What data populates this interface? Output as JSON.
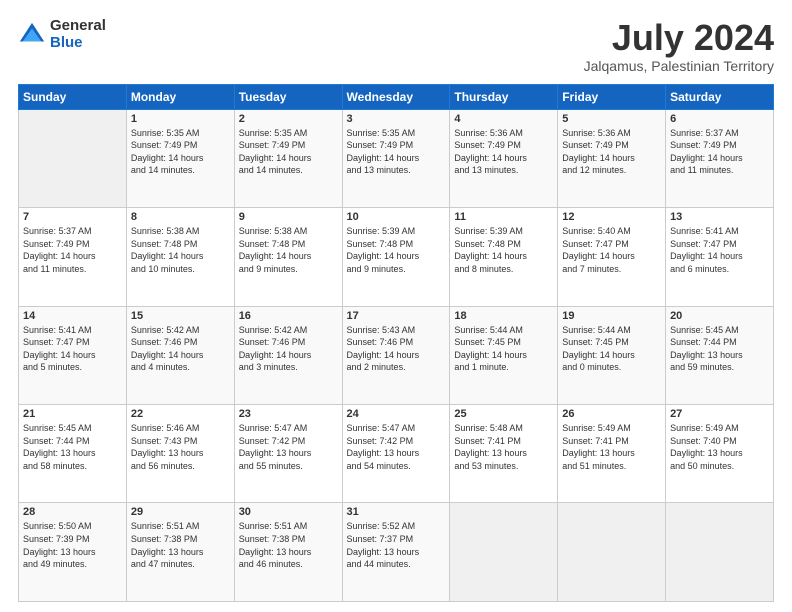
{
  "logo": {
    "general": "General",
    "blue": "Blue"
  },
  "header": {
    "month": "July 2024",
    "location": "Jalqamus, Palestinian Territory"
  },
  "days_of_week": [
    "Sunday",
    "Monday",
    "Tuesday",
    "Wednesday",
    "Thursday",
    "Friday",
    "Saturday"
  ],
  "weeks": [
    [
      {
        "day": "",
        "info": ""
      },
      {
        "day": "1",
        "info": "Sunrise: 5:35 AM\nSunset: 7:49 PM\nDaylight: 14 hours\nand 14 minutes."
      },
      {
        "day": "2",
        "info": "Sunrise: 5:35 AM\nSunset: 7:49 PM\nDaylight: 14 hours\nand 14 minutes."
      },
      {
        "day": "3",
        "info": "Sunrise: 5:35 AM\nSunset: 7:49 PM\nDaylight: 14 hours\nand 13 minutes."
      },
      {
        "day": "4",
        "info": "Sunrise: 5:36 AM\nSunset: 7:49 PM\nDaylight: 14 hours\nand 13 minutes."
      },
      {
        "day": "5",
        "info": "Sunrise: 5:36 AM\nSunset: 7:49 PM\nDaylight: 14 hours\nand 12 minutes."
      },
      {
        "day": "6",
        "info": "Sunrise: 5:37 AM\nSunset: 7:49 PM\nDaylight: 14 hours\nand 11 minutes."
      }
    ],
    [
      {
        "day": "7",
        "info": "Sunrise: 5:37 AM\nSunset: 7:49 PM\nDaylight: 14 hours\nand 11 minutes."
      },
      {
        "day": "8",
        "info": "Sunrise: 5:38 AM\nSunset: 7:48 PM\nDaylight: 14 hours\nand 10 minutes."
      },
      {
        "day": "9",
        "info": "Sunrise: 5:38 AM\nSunset: 7:48 PM\nDaylight: 14 hours\nand 9 minutes."
      },
      {
        "day": "10",
        "info": "Sunrise: 5:39 AM\nSunset: 7:48 PM\nDaylight: 14 hours\nand 9 minutes."
      },
      {
        "day": "11",
        "info": "Sunrise: 5:39 AM\nSunset: 7:48 PM\nDaylight: 14 hours\nand 8 minutes."
      },
      {
        "day": "12",
        "info": "Sunrise: 5:40 AM\nSunset: 7:47 PM\nDaylight: 14 hours\nand 7 minutes."
      },
      {
        "day": "13",
        "info": "Sunrise: 5:41 AM\nSunset: 7:47 PM\nDaylight: 14 hours\nand 6 minutes."
      }
    ],
    [
      {
        "day": "14",
        "info": "Sunrise: 5:41 AM\nSunset: 7:47 PM\nDaylight: 14 hours\nand 5 minutes."
      },
      {
        "day": "15",
        "info": "Sunrise: 5:42 AM\nSunset: 7:46 PM\nDaylight: 14 hours\nand 4 minutes."
      },
      {
        "day": "16",
        "info": "Sunrise: 5:42 AM\nSunset: 7:46 PM\nDaylight: 14 hours\nand 3 minutes."
      },
      {
        "day": "17",
        "info": "Sunrise: 5:43 AM\nSunset: 7:46 PM\nDaylight: 14 hours\nand 2 minutes."
      },
      {
        "day": "18",
        "info": "Sunrise: 5:44 AM\nSunset: 7:45 PM\nDaylight: 14 hours\nand 1 minute."
      },
      {
        "day": "19",
        "info": "Sunrise: 5:44 AM\nSunset: 7:45 PM\nDaylight: 14 hours\nand 0 minutes."
      },
      {
        "day": "20",
        "info": "Sunrise: 5:45 AM\nSunset: 7:44 PM\nDaylight: 13 hours\nand 59 minutes."
      }
    ],
    [
      {
        "day": "21",
        "info": "Sunrise: 5:45 AM\nSunset: 7:44 PM\nDaylight: 13 hours\nand 58 minutes."
      },
      {
        "day": "22",
        "info": "Sunrise: 5:46 AM\nSunset: 7:43 PM\nDaylight: 13 hours\nand 56 minutes."
      },
      {
        "day": "23",
        "info": "Sunrise: 5:47 AM\nSunset: 7:42 PM\nDaylight: 13 hours\nand 55 minutes."
      },
      {
        "day": "24",
        "info": "Sunrise: 5:47 AM\nSunset: 7:42 PM\nDaylight: 13 hours\nand 54 minutes."
      },
      {
        "day": "25",
        "info": "Sunrise: 5:48 AM\nSunset: 7:41 PM\nDaylight: 13 hours\nand 53 minutes."
      },
      {
        "day": "26",
        "info": "Sunrise: 5:49 AM\nSunset: 7:41 PM\nDaylight: 13 hours\nand 51 minutes."
      },
      {
        "day": "27",
        "info": "Sunrise: 5:49 AM\nSunset: 7:40 PM\nDaylight: 13 hours\nand 50 minutes."
      }
    ],
    [
      {
        "day": "28",
        "info": "Sunrise: 5:50 AM\nSunset: 7:39 PM\nDaylight: 13 hours\nand 49 minutes."
      },
      {
        "day": "29",
        "info": "Sunrise: 5:51 AM\nSunset: 7:38 PM\nDaylight: 13 hours\nand 47 minutes."
      },
      {
        "day": "30",
        "info": "Sunrise: 5:51 AM\nSunset: 7:38 PM\nDaylight: 13 hours\nand 46 minutes."
      },
      {
        "day": "31",
        "info": "Sunrise: 5:52 AM\nSunset: 7:37 PM\nDaylight: 13 hours\nand 44 minutes."
      },
      {
        "day": "",
        "info": ""
      },
      {
        "day": "",
        "info": ""
      },
      {
        "day": "",
        "info": ""
      }
    ]
  ]
}
